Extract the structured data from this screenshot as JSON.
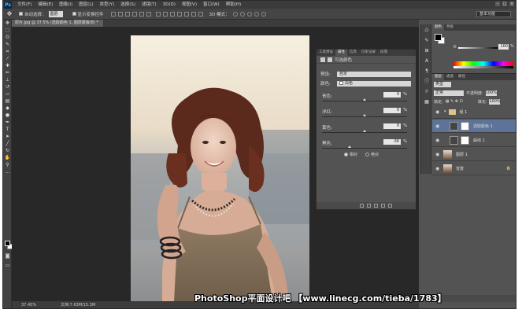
{
  "menubar": {
    "logo": "Ps",
    "items": [
      "文件(F)",
      "编辑(E)",
      "图像(I)",
      "图层(L)",
      "类型(Y)",
      "选择(S)",
      "滤镜(T)",
      "3D(D)",
      "视图(V)",
      "窗口(W)",
      "帮助(H)"
    ]
  },
  "options": {
    "auto_select": "自动选择：",
    "auto_select_target": "图层",
    "show_transform": "显示变换控件",
    "mode_3d": "3D 模式：",
    "workspace": "基本功能"
  },
  "document": {
    "tab_title": "原片.jpg @ 37.5% (选取颜色 1, 图层蒙版/8) *",
    "zoom": "37.45%",
    "doc_size": "文档:7.63M/15.3M"
  },
  "watermark": "PhotoShop平面设计吧 【www.linecg.com/tieba/1783】",
  "properties": {
    "tabs": [
      "工具预设",
      "属性",
      "信息",
      "历史记录",
      "段落"
    ],
    "active_tab": "属性",
    "title": "可选颜色",
    "preset_label": "预设:",
    "preset_value": "自定",
    "colors_label": "颜色:",
    "colors_value": "白色",
    "sliders": [
      {
        "label": "青色:",
        "value": "0",
        "unit": "%",
        "fraction": 0.5
      },
      {
        "label": "洋红:",
        "value": "0",
        "unit": "%",
        "fraction": 0.5
      },
      {
        "label": "黄色:",
        "value": "0",
        "unit": "%",
        "fraction": 0.5
      },
      {
        "label": "黑色:",
        "value": "-36",
        "unit": "%",
        "fraction": 0.32
      }
    ],
    "method_relative": "相对",
    "method_absolute": "绝对",
    "selected_method": "relative"
  },
  "color_panel": {
    "tabs": [
      "颜色",
      "色板"
    ],
    "channel": "K",
    "value": "100",
    "unit": "%"
  },
  "layers": {
    "tabs": [
      "图层",
      "通道",
      "路径"
    ],
    "filter": "类型",
    "blend_mode": "正常",
    "opacity_label": "不透明度:",
    "opacity_value": "100%",
    "lock_label": "锁定:",
    "fill_label": "填充:",
    "fill_value": "100%",
    "items": [
      {
        "name": "组 1",
        "kind": "group"
      },
      {
        "name": "选取颜色 1",
        "kind": "adjustment",
        "active": true
      },
      {
        "name": "曲线 1",
        "kind": "adjustment"
      },
      {
        "name": "图层 1",
        "kind": "pixel"
      },
      {
        "name": "背景",
        "kind": "background"
      }
    ]
  },
  "colors": {
    "workspace_bg": "#282828",
    "panel_bg": "#535353",
    "active_layer": "#5d7399"
  }
}
